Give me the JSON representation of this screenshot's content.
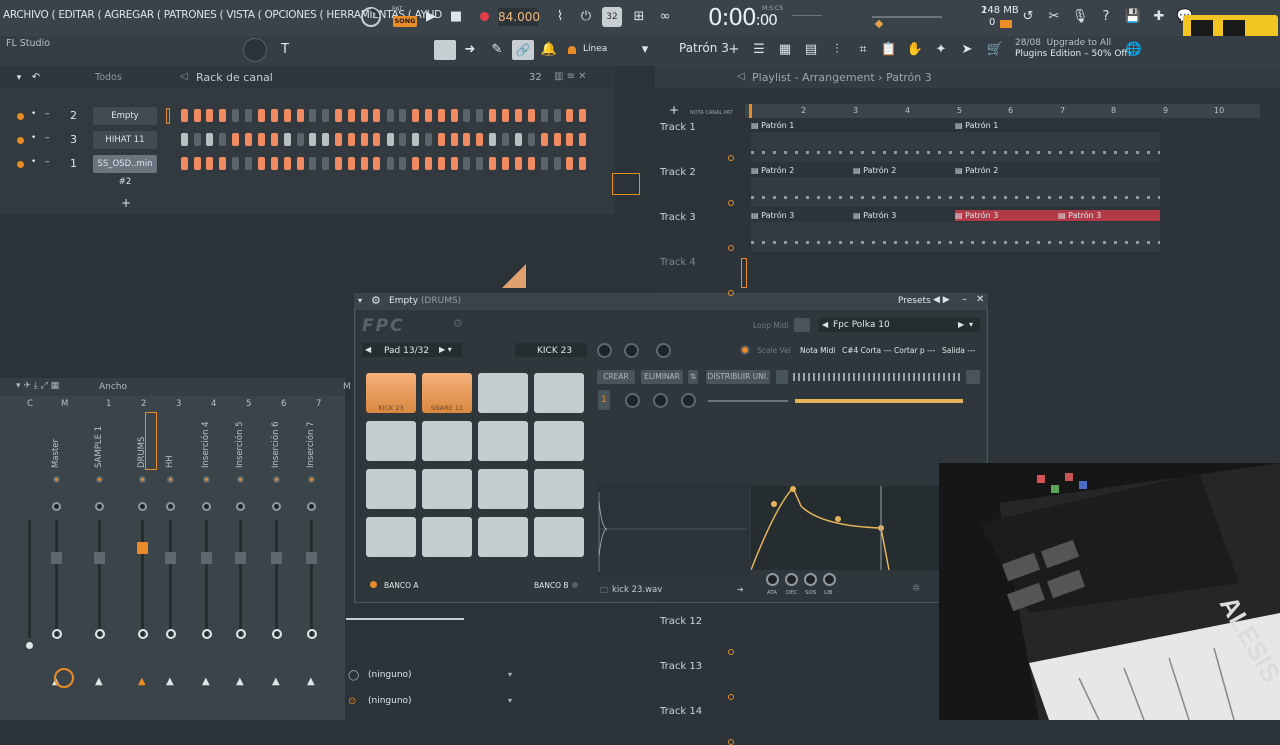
{
  "app": {
    "name": "FL Studio",
    "menus": [
      "ARCHIVO",
      "EDITAR",
      "AGREGAR",
      "PATRONES",
      "VISTA",
      "OPCIONES",
      "HERRAMIENTAS",
      "AYUD"
    ],
    "menu_line": "ARCHIVO ( EDITAR ( AGREGAR ( PATRONES ( VISTA ( OPCIONES ( HERRAMIENTAS ( AYUD"
  },
  "transport": {
    "pat_label": "PAT",
    "song_label": "SONG",
    "tempo": "84.000",
    "time": "0:00",
    "time_frac": "00",
    "time_unit": "M:S:CS",
    "pattern_32": "32",
    "cpu_count": "1",
    "memory": "248 MB",
    "voices": "0"
  },
  "toolbar2": {
    "snap": "Línea",
    "pattern": "Patrón 3",
    "news_date": "28/08",
    "news_line1": "Upgrade to All",
    "news_line2": "Plugins Edition – 50% Off!"
  },
  "channel_rack": {
    "filter": "Todos",
    "title": "Rack de canal",
    "swing": "32",
    "add_symbol": "+",
    "channels": [
      {
        "num": "2",
        "name": "Empty",
        "steps": [
          1,
          1,
          1,
          1,
          0,
          0,
          1,
          1,
          1,
          1,
          0,
          0,
          1,
          1,
          1,
          1,
          0,
          0,
          1,
          1,
          1,
          1,
          0,
          0,
          1,
          1,
          1,
          1,
          0,
          0,
          1,
          1
        ],
        "selected": false
      },
      {
        "num": "3",
        "name": "HIHAT 11",
        "steps": [
          2,
          0,
          2,
          0,
          1,
          1,
          1,
          1,
          2,
          0,
          2,
          2,
          1,
          1,
          1,
          1,
          2,
          0,
          2,
          0,
          1,
          1,
          1,
          1,
          2,
          0,
          2,
          0,
          1,
          1,
          1,
          1
        ],
        "selected": false
      },
      {
        "num": "1",
        "name": "SS_OSD..min #2",
        "steps": [
          1,
          1,
          1,
          1,
          0,
          0,
          1,
          1,
          1,
          1,
          0,
          0,
          1,
          1,
          1,
          1,
          0,
          0,
          1,
          1,
          1,
          1,
          0,
          0,
          1,
          1,
          1,
          1,
          0,
          0,
          1,
          1
        ],
        "selected": true
      }
    ]
  },
  "playlist": {
    "title": "Playlist - Arrangement",
    "pattern": "Patrón 3",
    "ruler": [
      "2",
      "3",
      "4",
      "5",
      "6",
      "7",
      "8",
      "9",
      "10"
    ],
    "tracks": [
      {
        "name": "Track 1",
        "clips": [
          "Patrón 1",
          "Patrón 1"
        ]
      },
      {
        "name": "Track 2",
        "clips": [
          "Patrón 2",
          "Patrón 2",
          "Patrón 2"
        ]
      },
      {
        "name": "Track 3",
        "clips": [
          "Patrón 3",
          "Patrón 3",
          "Patrón 3",
          "Patrón 3"
        ]
      },
      {
        "name": "Track 4",
        "clips": []
      },
      {
        "name": "Track 12",
        "clips": []
      },
      {
        "name": "Track 13",
        "clips": []
      },
      {
        "name": "Track 14",
        "clips": []
      }
    ],
    "header_icons_label": "NOTA CANAL PAT"
  },
  "fpc": {
    "title": "Empty",
    "subtitle": "(DRUMS)",
    "presets": "Presets",
    "logo": "FPC",
    "loop_midi": "Loop Midi",
    "preset_name": "Fpc Polka 10",
    "pad_select": "Pad 13/32",
    "sample_name": "KICK 23",
    "scale_vel": "Scale Vel",
    "nota_midi": "Nota Midi",
    "cut_info": "C#4 Corta --- Cortar p ---",
    "output": "Salida ---",
    "create": "CREAR",
    "delete": "ELIMINAR",
    "distribute": "DISTRIBUIR UNI.",
    "layer_num": "1",
    "pads": [
      {
        "label": "KICK 23",
        "active": true
      },
      {
        "label": "SNARE 11",
        "active": true
      },
      {
        "label": "",
        "active": false
      },
      {
        "label": "",
        "active": false
      },
      {
        "label": "",
        "active": false
      },
      {
        "label": "",
        "active": false
      },
      {
        "label": "",
        "active": false
      },
      {
        "label": "",
        "active": false
      },
      {
        "label": "",
        "active": false
      },
      {
        "label": "",
        "active": false
      },
      {
        "label": "",
        "active": false
      },
      {
        "label": "",
        "active": false
      },
      {
        "label": "",
        "active": false
      },
      {
        "label": "",
        "active": false
      },
      {
        "label": "",
        "active": false
      },
      {
        "label": "",
        "active": false
      }
    ],
    "bank_a": "BANCO A",
    "bank_b": "BANCO B",
    "wave_file": "kick 23.wav",
    "env_labels": [
      "ATA",
      "DEC",
      "SOS",
      "LIB"
    ]
  },
  "mixer": {
    "width_label": "Ancho",
    "columns": [
      "C",
      "M",
      "1",
      "2",
      "3",
      "4",
      "5",
      "6",
      "7"
    ],
    "inserts": [
      "Master",
      "SAMPLE 1",
      "DRUMS",
      "HH",
      "Inserción 4",
      "Inserción 5",
      "Inserción 6",
      "Inserción 7"
    ],
    "route1": "(ninguno)",
    "route2": "(ninguno)"
  },
  "colors": {
    "accent": "#f08a62",
    "orange": "#e98c28",
    "red_clip": "#b23a47",
    "bg": "#2b3338"
  }
}
